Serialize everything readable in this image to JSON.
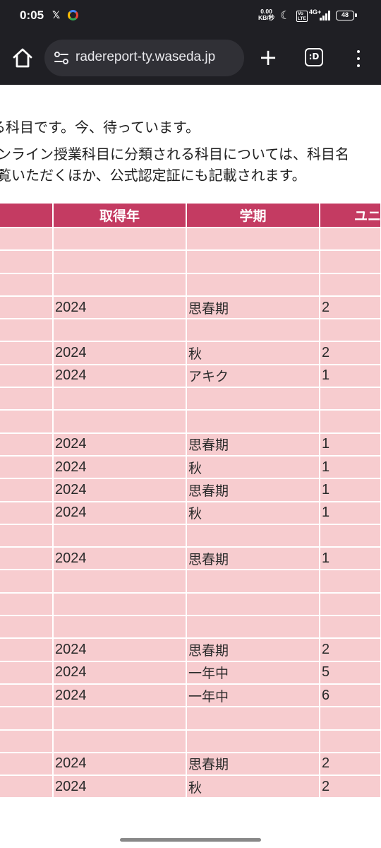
{
  "status_bar": {
    "time": "0:05",
    "x_label": "𝕏",
    "speed_value": "0.00",
    "speed_unit": "KB/秒",
    "volte": "Vo\nLTE",
    "network": "4G+",
    "battery": "48"
  },
  "browser": {
    "url": "radereport-ty.waseda.jp",
    "tabs_label": ":D",
    "newtab_label": "+"
  },
  "intro": {
    "line1": "る科目です。今、待っています。",
    "line2": "ンライン授業科目に分類される科目については、科目名",
    "line3": "覧いただくほか、公式認定証にも記載されます。"
  },
  "table": {
    "headers": [
      "",
      "取得年",
      "学期",
      "ユニ"
    ],
    "rows": [
      {
        "year": "",
        "term": "",
        "units": ""
      },
      {
        "year": "",
        "term": "",
        "units": ""
      },
      {
        "year": "",
        "term": "",
        "units": ""
      },
      {
        "year": "2024",
        "term": "思春期",
        "units": "2"
      },
      {
        "year": "",
        "term": "",
        "units": ""
      },
      {
        "year": "2024",
        "term": "秋",
        "units": "2"
      },
      {
        "year": "2024",
        "term": "アキク",
        "units": "1"
      },
      {
        "year": "",
        "term": "",
        "units": ""
      },
      {
        "year": "",
        "term": "",
        "units": ""
      },
      {
        "year": "2024",
        "term": "思春期",
        "units": "1"
      },
      {
        "year": "2024",
        "term": "秋",
        "units": "1"
      },
      {
        "year": "2024",
        "term": "思春期",
        "units": "1"
      },
      {
        "year": "2024",
        "term": "秋",
        "units": "1"
      },
      {
        "year": "",
        "term": "",
        "units": ""
      },
      {
        "year": "2024",
        "term": "思春期",
        "units": "1"
      },
      {
        "year": "",
        "term": "",
        "units": ""
      },
      {
        "year": "",
        "term": "",
        "units": ""
      },
      {
        "year": "",
        "term": "",
        "units": ""
      },
      {
        "year": "2024",
        "term": "思春期",
        "units": "2"
      },
      {
        "year": "2024",
        "term": "一年中",
        "units": "5"
      },
      {
        "year": "2024",
        "term": "一年中",
        "units": "6"
      },
      {
        "year": "",
        "term": "",
        "units": ""
      },
      {
        "year": "",
        "term": "",
        "units": ""
      },
      {
        "year": "2024",
        "term": "思春期",
        "units": "2"
      },
      {
        "year": "2024",
        "term": "秋",
        "units": "2"
      }
    ]
  },
  "colors": {
    "header_bg": "#c43b62",
    "cell_bg": "#f7cccf",
    "chrome_bg": "#1f1f24"
  }
}
